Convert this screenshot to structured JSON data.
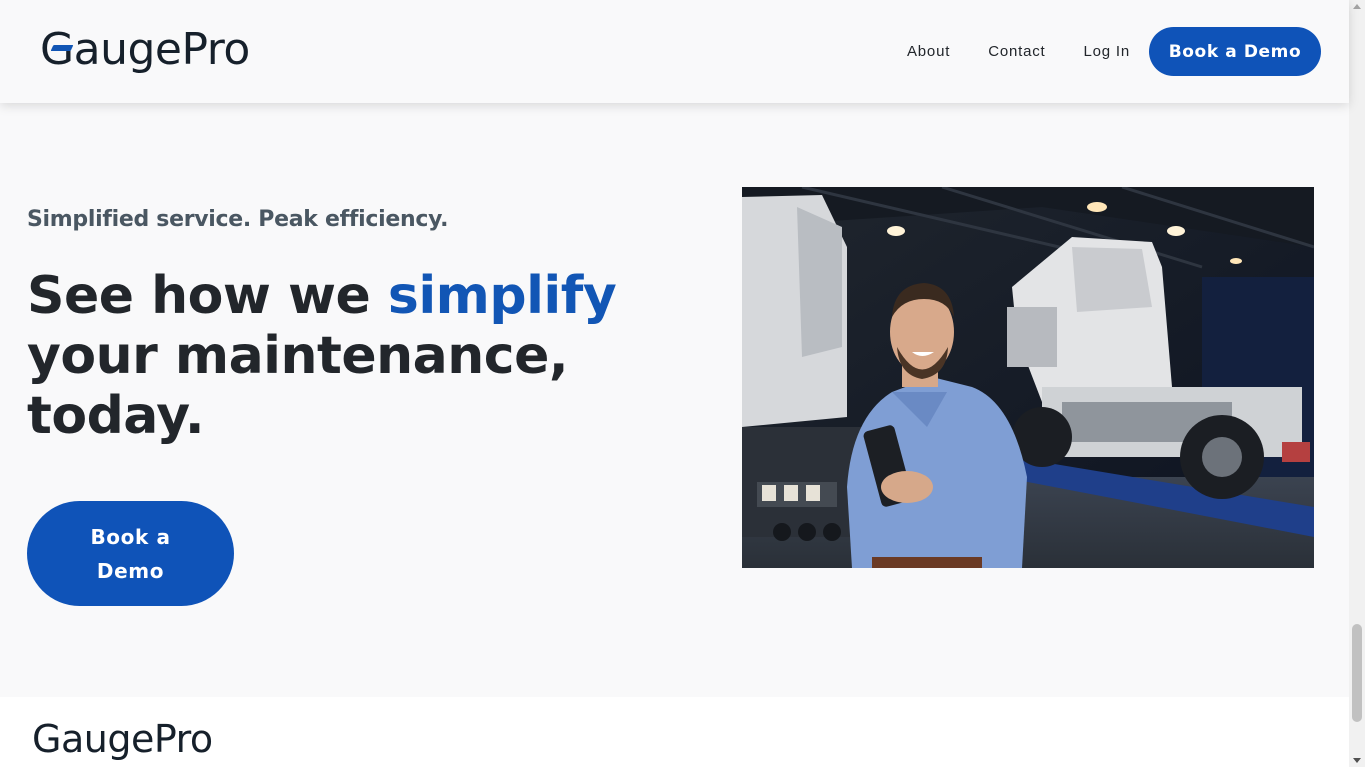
{
  "header": {
    "logo_prefix": "G",
    "logo_suffix": "augePro",
    "nav": [
      {
        "label": "About"
      },
      {
        "label": "Contact"
      },
      {
        "label": "Log In"
      }
    ],
    "cta_label": "Book a Demo"
  },
  "hero": {
    "tagline": "Simplified service. Peak efficiency.",
    "headline_part1": "See how we ",
    "headline_accent": "simplify",
    "headline_part2": " your maintenance, today.",
    "cta_label": "Book a Demo",
    "image_icon": "mechanic-with-tablet-photo"
  },
  "footer": {
    "logo_prefix": "G",
    "logo_suffix": "augePro"
  },
  "colors": {
    "brand_blue": "#0f53b8",
    "accent_text": "#1256b5",
    "text_dark": "#22262b",
    "page_bg": "#f9f9fa"
  }
}
